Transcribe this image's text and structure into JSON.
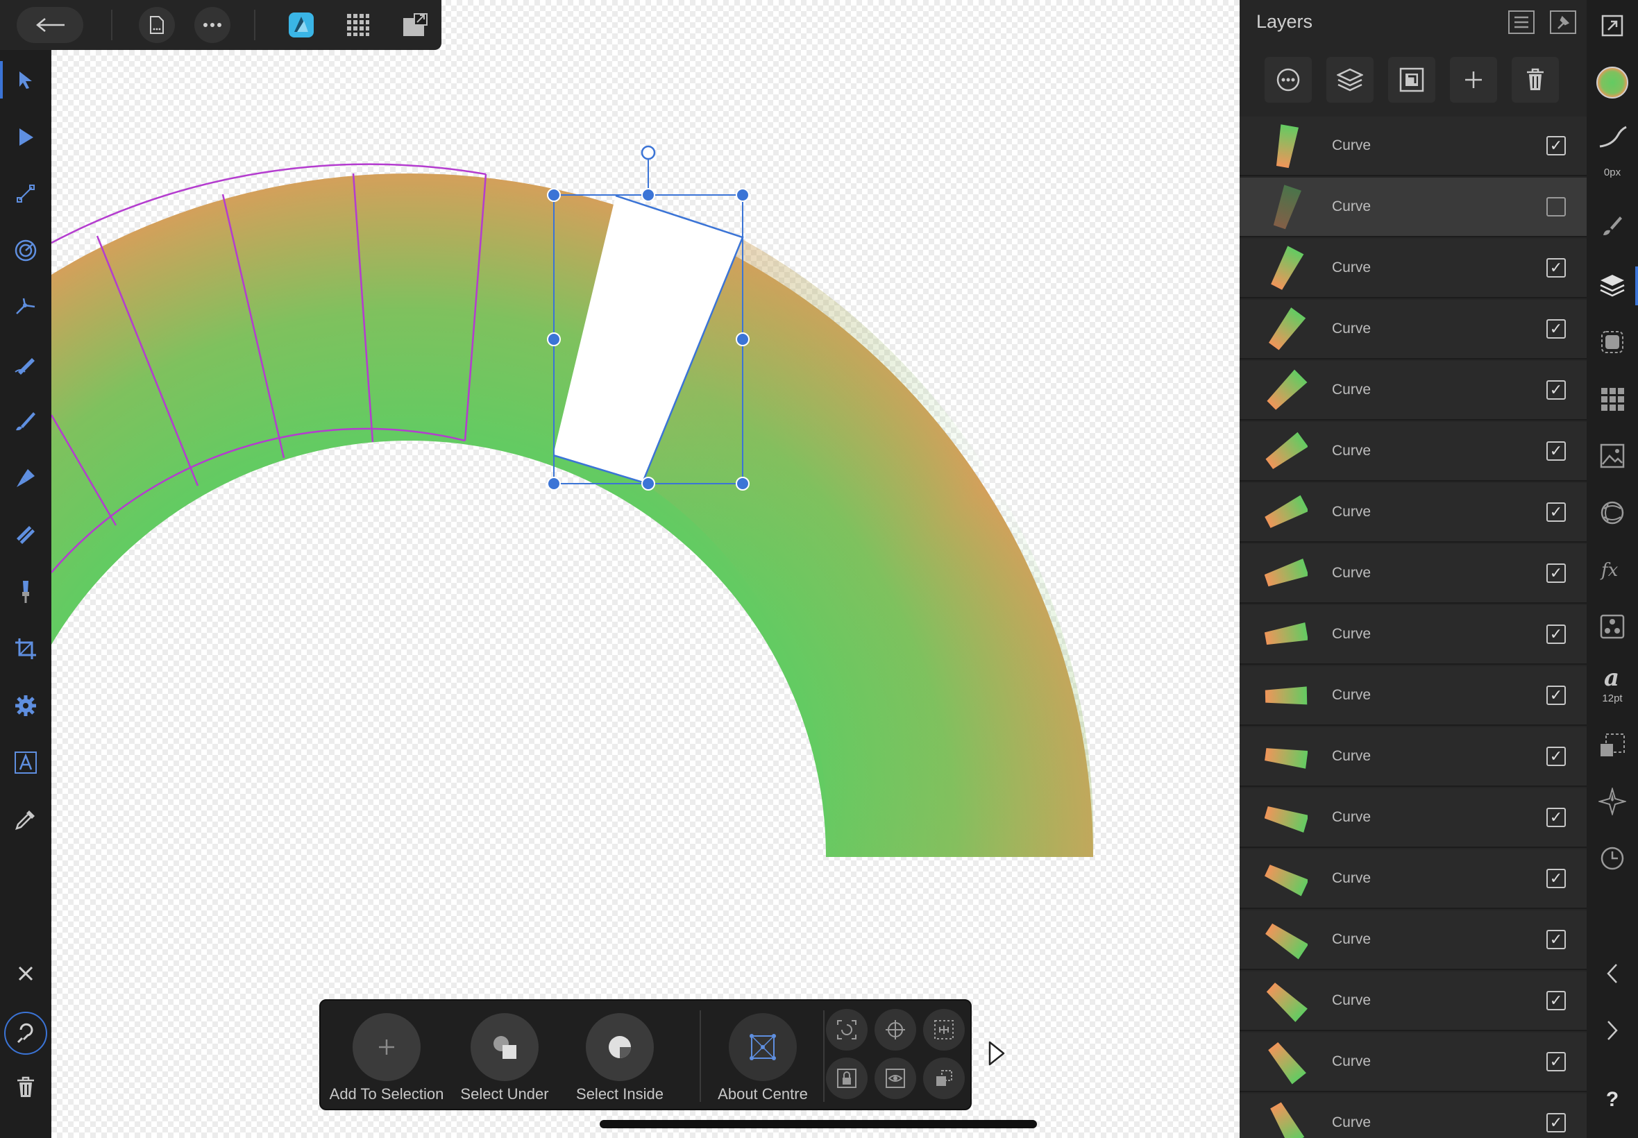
{
  "layers_panel": {
    "title": "Layers",
    "layers": [
      {
        "name": "Curve",
        "visible": true,
        "selected": false
      },
      {
        "name": "Curve",
        "visible": false,
        "selected": true
      },
      {
        "name": "Curve",
        "visible": true,
        "selected": false
      },
      {
        "name": "Curve",
        "visible": true,
        "selected": false
      },
      {
        "name": "Curve",
        "visible": true,
        "selected": false
      },
      {
        "name": "Curve",
        "visible": true,
        "selected": false
      },
      {
        "name": "Curve",
        "visible": true,
        "selected": false
      },
      {
        "name": "Curve",
        "visible": true,
        "selected": false
      },
      {
        "name": "Curve",
        "visible": true,
        "selected": false
      },
      {
        "name": "Curve",
        "visible": true,
        "selected": false
      },
      {
        "name": "Curve",
        "visible": true,
        "selected": false
      },
      {
        "name": "Curve",
        "visible": true,
        "selected": false
      },
      {
        "name": "Curve",
        "visible": true,
        "selected": false
      },
      {
        "name": "Curve",
        "visible": true,
        "selected": false
      },
      {
        "name": "Curve",
        "visible": true,
        "selected": false
      },
      {
        "name": "Curve",
        "visible": true,
        "selected": false
      },
      {
        "name": "Curve",
        "visible": true,
        "selected": false
      }
    ]
  },
  "right_strip": {
    "stroke_width": "0px",
    "font_size": "12pt",
    "help": "?"
  },
  "context_toolbar": {
    "add_to_selection": "Add To Selection",
    "select_under": "Select Under",
    "select_inside": "Select Inside",
    "about_centre": "About Centre"
  },
  "colors": {
    "gradient_orange": "#f0955a",
    "gradient_green": "#63cb62",
    "selection_blue": "#3b74d6",
    "outline_magenta": "#b43ccf",
    "accent_cyan": "#3ab5e6"
  }
}
